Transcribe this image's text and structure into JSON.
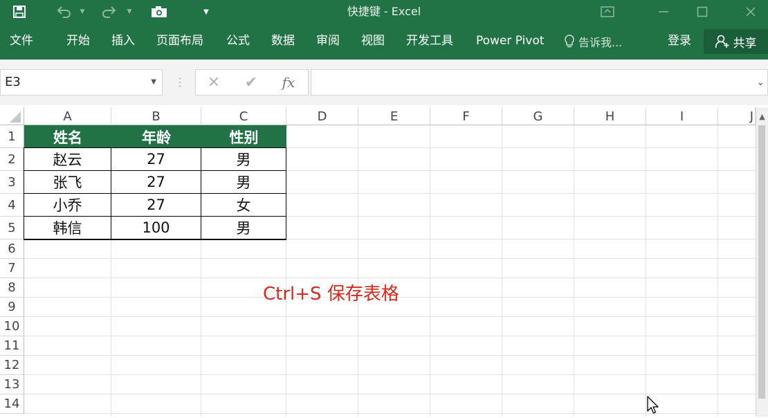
{
  "window": {
    "title": "快捷键 - Excel",
    "accent": "#217346"
  },
  "ribbon": {
    "tabs": [
      "文件",
      "开始",
      "插入",
      "页面布局",
      "公式",
      "数据",
      "审阅",
      "视图",
      "开发工具",
      "Power Pivot"
    ],
    "tell_me": "告诉我...",
    "login": "登录",
    "share": "共享"
  },
  "formula_bar": {
    "name_box": "E3",
    "fx_label": "fx",
    "formula": ""
  },
  "sheet": {
    "columns": [
      "A",
      "B",
      "C",
      "D",
      "E",
      "F",
      "G",
      "H",
      "I",
      "J"
    ],
    "rows": [
      "1",
      "2",
      "3",
      "4",
      "5",
      "6",
      "7",
      "8",
      "9",
      "10",
      "11",
      "12",
      "13",
      "14"
    ],
    "table": {
      "header": [
        "姓名",
        "年龄",
        "性别"
      ],
      "rows": [
        [
          "赵云",
          "27",
          "男"
        ],
        [
          "张飞",
          "27",
          "男"
        ],
        [
          "小乔",
          "27",
          "女"
        ],
        [
          "韩信",
          "100",
          "男"
        ]
      ]
    },
    "annotation": "Ctrl+S 保存表格",
    "annotation_color": "#d52a1e"
  },
  "icons": {
    "save": "save-icon",
    "undo": "undo-icon",
    "redo": "redo-icon",
    "camera": "camera-icon",
    "customize": "customize-qat-icon",
    "ribbon_display": "ribbon-display-icon",
    "minimize": "minimize-icon",
    "maximize": "maximize-icon",
    "close": "close-icon",
    "lightbulb": "lightbulb-icon",
    "user": "user-icon",
    "cursor": "mouse-cursor-icon"
  }
}
